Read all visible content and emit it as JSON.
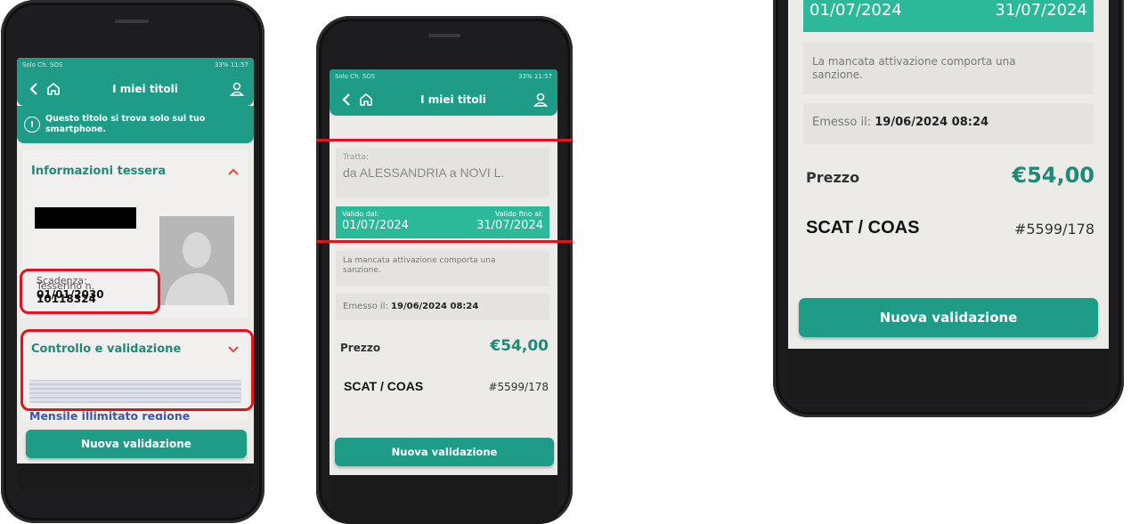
{
  "statusbar": {
    "carrier": "Solo Ch. SOS",
    "battery": "33%",
    "time": "11:57"
  },
  "appbar": {
    "title": "I miei titoli"
  },
  "alert": {
    "text": "Questo titolo si trova solo sul tuo smartphone."
  },
  "tessera": {
    "header": "Informazioni tessera",
    "card_label": "Tesserino n.",
    "card_number": "10118324",
    "expiry_label": "Scadenza:",
    "expiry_value": "01/01/2030"
  },
  "controllo": {
    "header": "Controllo e validazione"
  },
  "product_name": "Mensile illimitato regione",
  "ticket": {
    "route_label": "Tratta:",
    "route_value": "da ALESSANDRIA a NOVI L.",
    "valid_from_label": "Valido dal:",
    "valid_from_value": "01/07/2024",
    "valid_to_label": "Valido fino al:",
    "valid_to_value": "31/07/2024",
    "activation_note": "La mancata attivazione comporta una sanzione.",
    "issued_label": "Emesso il:",
    "issued_value": "19/06/2024 08:24",
    "price_label": "Prezzo",
    "price_value": "€54,00",
    "operator": "SCAT / COAS",
    "ticket_code": "#5599/178"
  },
  "button": {
    "nuova_validazione": "Nuova validazione"
  },
  "colors": {
    "brand_teal": "#1f9c88",
    "highlight_red": "#e0141e",
    "background": "#ecebe8"
  }
}
